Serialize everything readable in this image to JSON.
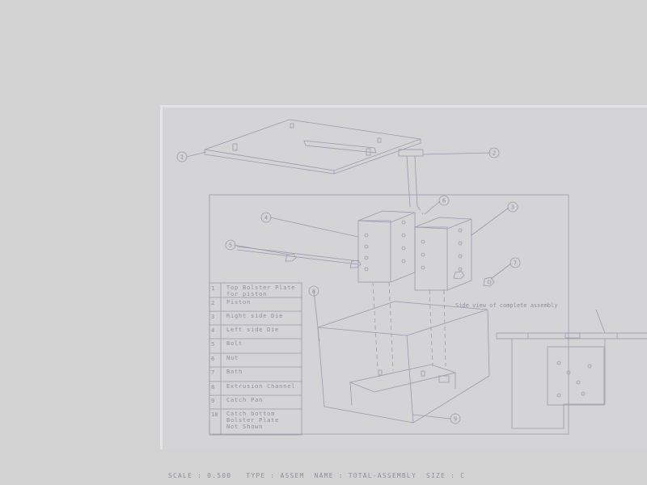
{
  "drawing": {
    "parts": [
      {
        "num": "1",
        "name": [
          "Top Bolster Plate",
          "for piston"
        ]
      },
      {
        "num": "2",
        "name": [
          "Piston"
        ]
      },
      {
        "num": "3",
        "name": [
          "Right side Die"
        ]
      },
      {
        "num": "4",
        "name": [
          "Left side Die"
        ]
      },
      {
        "num": "5",
        "name": [
          "Bolt"
        ]
      },
      {
        "num": "6",
        "name": [
          "Nut"
        ]
      },
      {
        "num": "7",
        "name": [
          "Bath"
        ]
      },
      {
        "num": "8",
        "name": [
          "Extrusion Channel"
        ]
      },
      {
        "num": "9",
        "name": [
          "Catch Pan"
        ]
      },
      {
        "num": "10",
        "name": [
          "Catch bottom",
          "Bolster Plate",
          "Not Shown"
        ]
      }
    ],
    "side_view_label": "Side view of complete assembly",
    "balloons": [
      "1",
      "2",
      "3",
      "4",
      "5",
      "6",
      "7",
      "8",
      "9"
    ]
  },
  "status": {
    "scale_label": "SCALE",
    "scale_value": "0.500",
    "type_label": "TYPE",
    "type_value": "ASSEM",
    "name_label": "NAME",
    "name_value": "TOTAL-ASSEMBLY",
    "size_label": "SIZE",
    "size_value": "C"
  },
  "colors": {
    "line": "#9a9aae",
    "text": "#8f8f9e",
    "background": "#d2d2d2",
    "sheet": "#d4d4d6"
  }
}
